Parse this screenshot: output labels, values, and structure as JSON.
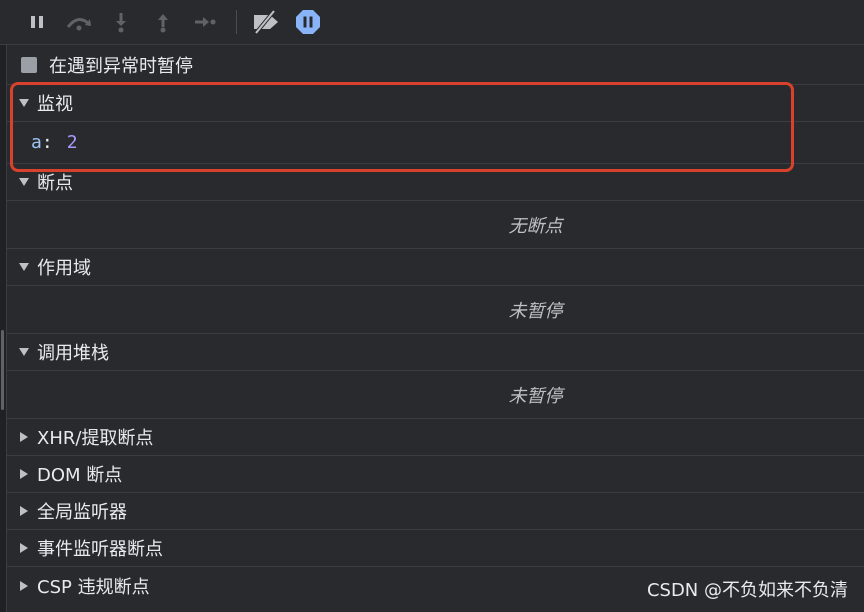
{
  "checkbox": {
    "label": "在遇到异常时暂停",
    "checked": false
  },
  "sections": {
    "watch": {
      "title": "监视",
      "expanded": true,
      "item": {
        "name": "a",
        "colon": ":",
        "value": "2"
      }
    },
    "breakpoints": {
      "title": "断点",
      "expanded": true,
      "empty": "无断点"
    },
    "scope": {
      "title": "作用域",
      "expanded": true,
      "empty": "未暂停"
    },
    "callstack": {
      "title": "调用堆栈",
      "expanded": true,
      "empty": "未暂停"
    },
    "xhr": {
      "title": "XHR/提取断点",
      "expanded": false
    },
    "dom": {
      "title": "DOM 断点",
      "expanded": false
    },
    "global": {
      "title": "全局监听器",
      "expanded": false
    },
    "event": {
      "title": "事件监听器断点",
      "expanded": false
    },
    "csp": {
      "title": "CSP 违规断点",
      "expanded": false
    }
  },
  "watermark": "CSDN @不负如来不负清",
  "colors": {
    "background": "#292a2d",
    "highlight": "#d9412c",
    "active_icon": "#8ab4f8",
    "watch_value": "#a59bff"
  },
  "toolbar_icons": [
    "pause-icon",
    "step-over-icon",
    "step-into-icon",
    "step-out-icon",
    "step-icon",
    "deactivate-breakpoints-icon",
    "pause-on-exceptions-icon"
  ]
}
